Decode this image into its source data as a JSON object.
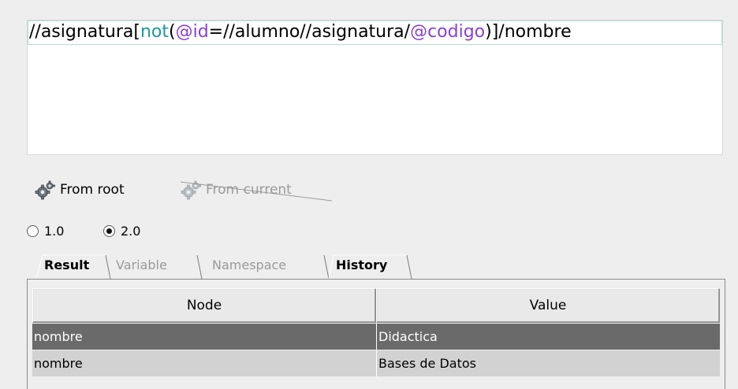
{
  "editor": {
    "tokens": [
      {
        "text": "//asignatura[",
        "color": "#000000"
      },
      {
        "text": "not",
        "color": "#1b9a9a"
      },
      {
        "text": "(",
        "color": "#000000"
      },
      {
        "text": "@id",
        "color": "#8a3fd8"
      },
      {
        "text": "=//alumno//asignatura/",
        "color": "#000000"
      },
      {
        "text": "@codigo",
        "color": "#8a3fd8"
      },
      {
        "text": ")]/nombre",
        "color": "#000000"
      }
    ]
  },
  "toolbar": {
    "from_root_label": "From root",
    "from_root_icon": "gears-icon",
    "from_current_label": "From current",
    "from_current_icon": "gears-icon"
  },
  "version": {
    "options": [
      "1.0",
      "2.0"
    ],
    "selected": "2.0"
  },
  "tabs": {
    "result": "Result",
    "variable": "Variable",
    "namespace": "Namespace",
    "history": "History"
  },
  "table": {
    "columns": [
      "Node",
      "Value"
    ],
    "rows": [
      {
        "node": "nombre",
        "value": "Didactica"
      },
      {
        "node": "nombre",
        "value": "Bases de Datos"
      }
    ]
  },
  "colors": {
    "xpath_function": "#1b9a9a",
    "xpath_attribute": "#8a3fd8",
    "row_selected": "#6a6a6a",
    "row_alt": "#d2d2d2"
  }
}
